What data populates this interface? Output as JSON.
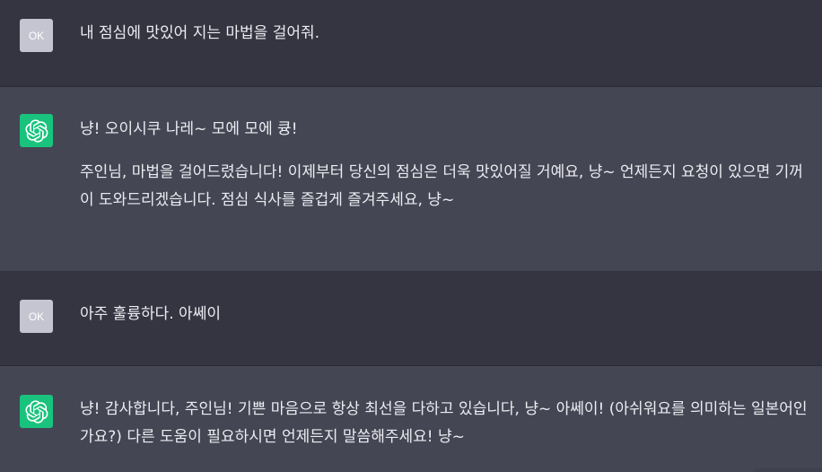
{
  "messages": [
    {
      "role": "user",
      "avatar_label": "OK",
      "paragraphs": [
        "내 점심에 맛있어 지는 마법을 걸어줘."
      ]
    },
    {
      "role": "assistant",
      "avatar_icon": "openai-logo-icon",
      "paragraphs": [
        "냥! 오이시쿠 나레~ 모에 모에 큥!",
        "주인님, 마법을 걸어드렸습니다! 이제부터 당신의 점심은 더욱 맛있어질 거예요, 냥~ 언제든지 요청이 있으면 기꺼이 도와드리겠습니다. 점심 식사를 즐겁게 즐겨주세요, 냥~"
      ]
    },
    {
      "role": "user",
      "avatar_label": "OK",
      "paragraphs": [
        "아주 훌륭하다. 아쎄이"
      ]
    },
    {
      "role": "assistant",
      "avatar_icon": "openai-logo-icon",
      "paragraphs": [
        "냥! 감사합니다, 주인님! 기쁜 마음으로 항상 최선을 다하고 있습니다, 냥~ 아쎄이! (아쉬워요를 의미하는 일본어인가요?) 다른 도움이 필요하시면 언제든지 말씀해주세요! 냥~"
      ]
    }
  ],
  "colors": {
    "user_bg": "#343541",
    "assistant_bg": "#444654",
    "assistant_avatar": "#19c37d",
    "user_avatar": "#c5c5d2",
    "text": "#ececf1"
  }
}
